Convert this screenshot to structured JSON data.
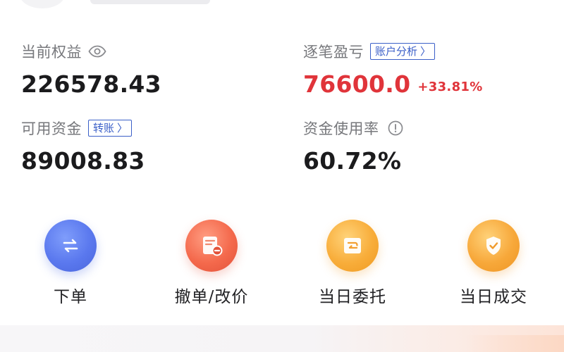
{
  "account": {
    "equity": {
      "label": "当前权益",
      "value": "226578.43",
      "icon": "eye-icon"
    },
    "pnl": {
      "label": "逐笔盈亏",
      "value": "76600.0",
      "change": "+33.81%",
      "link_label": "账户分析",
      "link_chevron": "〉",
      "color": "#e0343a"
    },
    "available": {
      "label": "可用资金",
      "value": "89008.83",
      "link_label": "转账",
      "link_chevron": "〉"
    },
    "usage": {
      "label": "资金使用率",
      "value": "60.72%",
      "icon": "info-icon"
    }
  },
  "actions": [
    {
      "label": "下单",
      "icon": "swap-arrows-icon",
      "color": "#5a78ee"
    },
    {
      "label": "撤单/改价",
      "icon": "cancel-order-icon",
      "color": "#f4694c"
    },
    {
      "label": "当日委托",
      "icon": "order-return-icon",
      "color": "#f8ad3a"
    },
    {
      "label": "当日成交",
      "icon": "shield-check-icon",
      "color": "#f7a83a"
    }
  ],
  "colors": {
    "link": "#3b5fc8",
    "label": "#77787c",
    "value": "#1b1b1d"
  }
}
